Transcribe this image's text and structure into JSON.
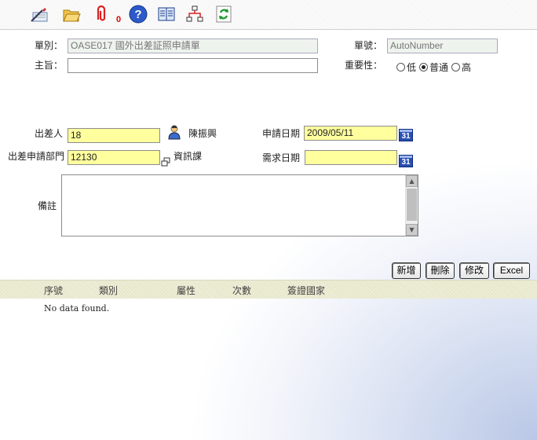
{
  "toolbar": {
    "attachment_count": "0",
    "icons": [
      "edit-icon",
      "folder-open-icon",
      "paperclip-icon",
      "help-icon",
      "book-icon",
      "flowchart-icon",
      "refresh-icon"
    ]
  },
  "form": {
    "doc_type_label": "單別：",
    "doc_type_value": "OASE017 國外出差証照申請單",
    "doc_no_label": "單號：",
    "doc_no_value": "AutoNumber",
    "subject_label": "主旨：",
    "subject_value": "",
    "priority_label": "重要性：",
    "priority_options": [
      "低",
      "普通",
      "高"
    ],
    "priority_selected": "普通",
    "traveler_label": "出差人",
    "traveler_id": "18",
    "traveler_name": "陳振興",
    "apply_date_label": "申請日期",
    "apply_date_value": "2009/05/11",
    "dept_label": "出差申請部門",
    "dept_id": "12130",
    "dept_name": "資訊課",
    "need_date_label": "需求日期",
    "need_date_value": "",
    "calendar_label": "31",
    "remark_label": "備註",
    "remark_value": ""
  },
  "buttons": {
    "add": "新增",
    "delete": "刪除",
    "edit": "修改",
    "excel": "Excel"
  },
  "grid": {
    "columns": [
      "序號",
      "類別",
      "屬性",
      "次數",
      "簽證國家"
    ],
    "rows": [],
    "empty_text": "No data found."
  },
  "colors": {
    "highlight_field": "#ffff9e",
    "readonly_field": "#eef3ee",
    "grid_header": "#e8e8cf"
  }
}
